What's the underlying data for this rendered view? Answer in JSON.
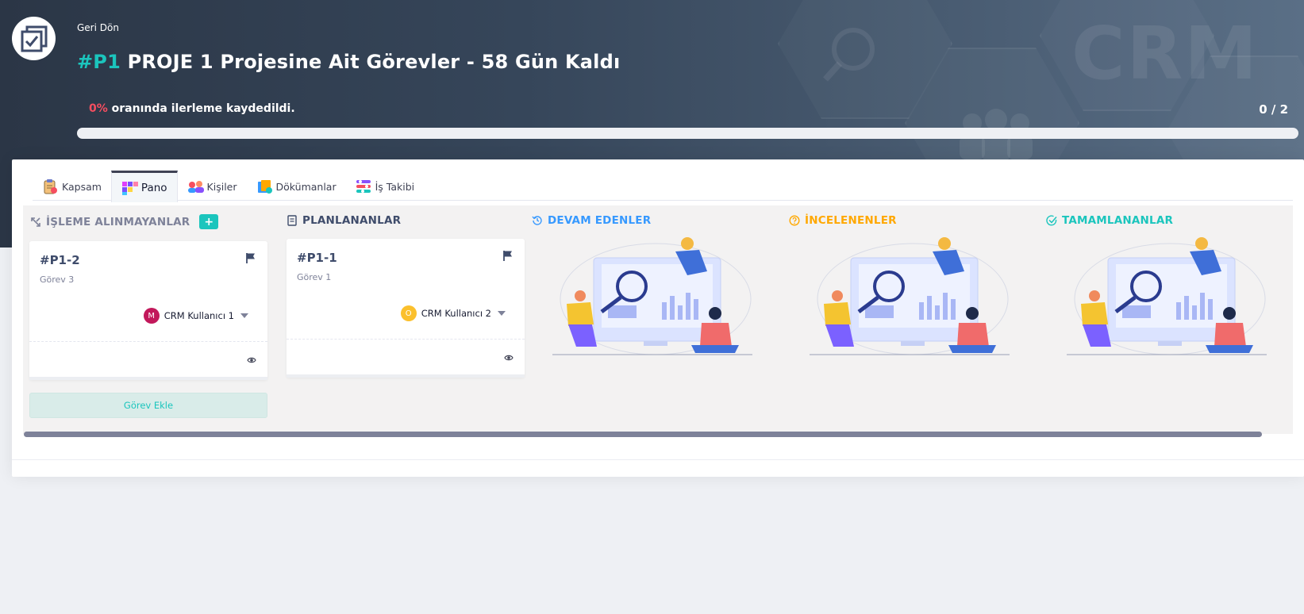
{
  "header": {
    "back_label": "Geri Dön",
    "project_code": "#P1",
    "title_text": "PROJE 1 Projesine Ait Görevler - 58 Gün Kaldı",
    "background_watermark": "CRM",
    "progress_percent": "0%",
    "progress_suffix": "oranında ilerleme kaydedildi.",
    "progress_count": "0 / 2",
    "progress_value": 0
  },
  "tabs": [
    {
      "label": "Kapsam",
      "icon": "clipboard-icon"
    },
    {
      "label": "Pano",
      "icon": "kanban-board-icon",
      "active": true
    },
    {
      "label": "Kişiler",
      "icon": "people-icon"
    },
    {
      "label": "Dökümanlar",
      "icon": "documents-icon"
    },
    {
      "label": "İş Takibi",
      "icon": "task-tracking-icon"
    }
  ],
  "columns": [
    {
      "title": "İŞLEME ALINMAYANLAR",
      "color": "#7e8299",
      "icon": "not-started-icon"
    },
    {
      "title": "PLANLANANLAR",
      "color": "#3f4c6b",
      "icon": "list-icon"
    },
    {
      "title": "DEVAM EDENLER",
      "color": "#3699ff",
      "icon": "history-icon"
    },
    {
      "title": "İNCELENENLER",
      "color": "#ffa800",
      "icon": "question-circle-icon"
    },
    {
      "title": "TAMAMLANANLAR",
      "color": "#1bc5bd",
      "icon": "check-circle-icon"
    }
  ],
  "tasks": [
    {
      "code": "#P1-2",
      "name": "Görev 3",
      "assignee": "CRM Kullanıcı 1",
      "avatar_letter": "M",
      "avatar_color": "#c2185b"
    },
    {
      "code": "#P1-1",
      "name": "Görev 1",
      "assignee": "CRM Kullanıcı 2",
      "avatar_letter": "O",
      "avatar_color": "#fbc02d"
    }
  ],
  "add_task_label": "Görev Ekle",
  "colors": {
    "accent": "#1bc5bd",
    "danger": "#f64e60",
    "primary": "#3699ff",
    "warning": "#ffa800"
  }
}
